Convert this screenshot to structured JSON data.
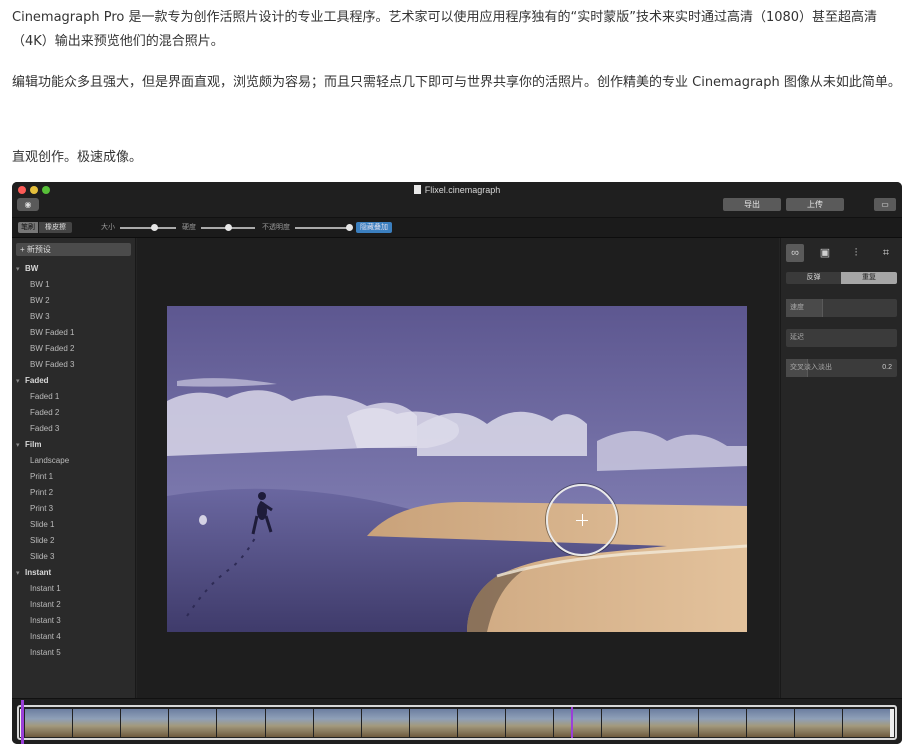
{
  "article": {
    "paragraph_1": "Cinemagraph Pro 是一款专为创作活照片设计的专业工具程序。艺术家可以使用应用程序独有的“实时蒙版”技术来实时通过高清（1080）甚至超高清（4K）输出来预览他们的混合照片。",
    "paragraph_2": "编辑功能众多且强大，但是界面直观，浏览颇为容易；而且只需轻点几下即可与世界共享你的活照片。创作精美的专业 Cinemagraph 图像从未如此简单。",
    "paragraph_3": "直观创作。极速成像。"
  },
  "window": {
    "title": "Flixel.cinemagraph",
    "export_label": "导出",
    "upload_label": "上传"
  },
  "toolbar": {
    "brush_label": "笔刷",
    "eraser_label": "橡皮擦",
    "size_label": "大小",
    "size_level": 0.62,
    "hardness_label": "硬度",
    "hardness_level": 0.5,
    "opacity_label": "不透明度",
    "opacity_level": 1.0,
    "overlay_label": "隐藏叠加"
  },
  "sidebar": {
    "new_preset_label": "+ 新预设",
    "groups": [
      {
        "name": "BW",
        "items": [
          "BW 1",
          "BW 2",
          "BW 3",
          "BW Faded 1",
          "BW Faded 2",
          "BW Faded 3"
        ]
      },
      {
        "name": "Faded",
        "items": [
          "Faded 1",
          "Faded 2",
          "Faded 3"
        ]
      },
      {
        "name": "Film",
        "items": [
          "Landscape",
          "Print 1",
          "Print 2",
          "Print 3",
          "Slide 1",
          "Slide 2",
          "Slide 3"
        ]
      },
      {
        "name": "Instant",
        "items": [
          "Instant 1",
          "Instant 2",
          "Instant 3",
          "Instant 4",
          "Instant 5"
        ]
      }
    ]
  },
  "right_panel": {
    "bounce_label": "反弹",
    "repeat_label": "重复",
    "speed_label": "速度",
    "delay_label": "延迟",
    "crossfade_label": "交叉淡入淡出",
    "crossfade_value": "0.2",
    "speed_level": 0.33,
    "crossfade_level": 0.2
  },
  "timeline": {
    "frame_count": 18,
    "playhead_position": 0.63
  },
  "colors": {
    "mask_overlay": "#7a76b8",
    "accent_blue": "#3b7fbf",
    "playhead": "#9b3fd8"
  }
}
